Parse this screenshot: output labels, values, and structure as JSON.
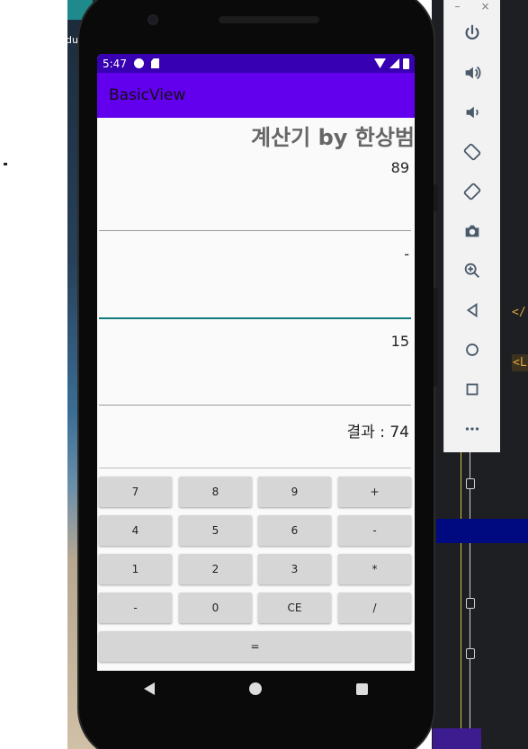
{
  "status_bar": {
    "time": "5:47"
  },
  "app_bar": {
    "title": "BasicView"
  },
  "calculator": {
    "title": "계산기 by 한상범",
    "first_operand": "89",
    "operator": "-",
    "second_operand": "15",
    "result": "결과 : 74"
  },
  "keypad": {
    "row1": [
      "7",
      "8",
      "9",
      "+"
    ],
    "row2": [
      "4",
      "5",
      "6",
      "-"
    ],
    "row3": [
      "1",
      "2",
      "3",
      "*"
    ],
    "row4": [
      "-",
      "0",
      "CE",
      "/"
    ],
    "equals": "="
  },
  "emulator_toolbar": {
    "minimize": "–",
    "close": "×",
    "buttons": [
      "power-icon",
      "volume-up-icon",
      "volume-down-icon",
      "rotate-left-icon",
      "rotate-right-icon",
      "camera-icon",
      "zoom-icon",
      "back-icon",
      "home-icon",
      "overview-icon",
      "more-icon"
    ]
  },
  "ide": {
    "tag1": "</",
    "tag2": "<L"
  },
  "desktop": {
    "icon_label": "du"
  },
  "colors": {
    "status_bar": "#3700b3",
    "app_bar": "#6200ee",
    "focus_underline": "#117a7a",
    "key_bg": "#d6d6d6"
  }
}
